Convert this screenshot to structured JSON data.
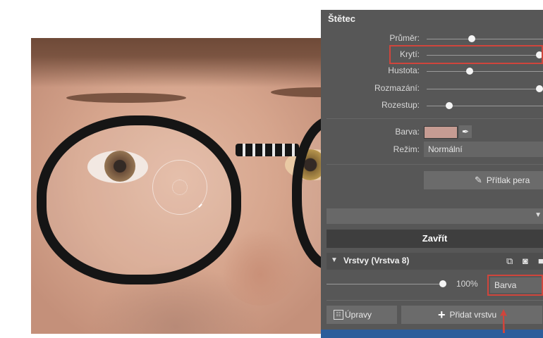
{
  "panel": {
    "title": "Štětec",
    "sliders": [
      {
        "label": "Průměr:",
        "value": 0.4
      },
      {
        "label": "Krytí:",
        "value": 1.0
      },
      {
        "label": "Hustota:",
        "value": 0.38
      },
      {
        "label": "Rozmazání:",
        "value": 1.0
      },
      {
        "label": "Rozestup:",
        "value": 0.2
      }
    ],
    "color_label": "Barva:",
    "color_value": "#c69c93",
    "mode_label": "Režim:",
    "mode_value": "Normální",
    "pen_pressure_button": "Přítlak pera",
    "close_button": "Zavřít"
  },
  "layers": {
    "title": "Vrstvy (Vrstva 8)",
    "opacity": "100%",
    "opacity_value": 1.0,
    "blend_mode": "Barva",
    "adjust_button": "Úpravy",
    "add_layer_button": "Přidat vrstvu"
  },
  "colors": {
    "panel_bg": "#575757",
    "highlight": "#d0453c",
    "accent_blue": "#2c5d9b"
  },
  "icons": {
    "eyedropper": "eyedropper-icon",
    "pen": "pen-icon",
    "dropdown": "chevron-down-icon",
    "collapse": "triangle-down-icon",
    "duplicate": "duplicate-layer-icon",
    "mask": "mask-icon",
    "adjust": "adjustments-icon",
    "plus": "plus-icon"
  }
}
